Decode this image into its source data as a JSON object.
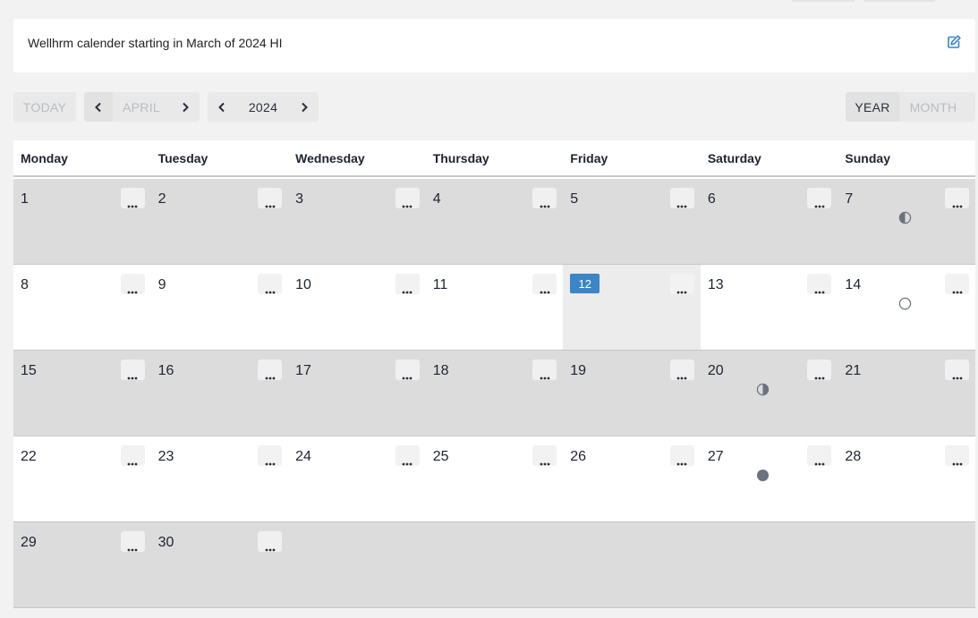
{
  "header": {
    "title": "Wellhrm calender starting in March of 2024 HI"
  },
  "toolbar": {
    "today_label": "TODAY",
    "month_label": "APRIL",
    "year_label": "2024",
    "view_year_label": "YEAR",
    "view_month_label": "MONTH"
  },
  "calendar": {
    "weekdays": [
      "Monday",
      "Tuesday",
      "Wednesday",
      "Thursday",
      "Friday",
      "Saturday",
      "Sunday"
    ],
    "weeks": [
      [
        "1",
        "2",
        "3",
        "4",
        "5",
        "6",
        "7"
      ],
      [
        "8",
        "9",
        "10",
        "11",
        "12",
        "13",
        "14"
      ],
      [
        "15",
        "16",
        "17",
        "18",
        "19",
        "20",
        "21"
      ],
      [
        "22",
        "23",
        "24",
        "25",
        "26",
        "27",
        "28"
      ],
      [
        "29",
        "30",
        "",
        "",
        "",
        "",
        ""
      ]
    ],
    "today": "12",
    "moon_phases": [
      {
        "day": "7",
        "phase": "last-quarter-icon"
      },
      {
        "day": "14",
        "phase": "new-moon-icon"
      },
      {
        "day": "20",
        "phase": "first-quarter-icon"
      },
      {
        "day": "27",
        "phase": "full-moon-icon"
      }
    ]
  },
  "colors": {
    "accent": "#3a86c6",
    "shaded_row": "#dcdcdc",
    "moon": "#6b7280"
  }
}
